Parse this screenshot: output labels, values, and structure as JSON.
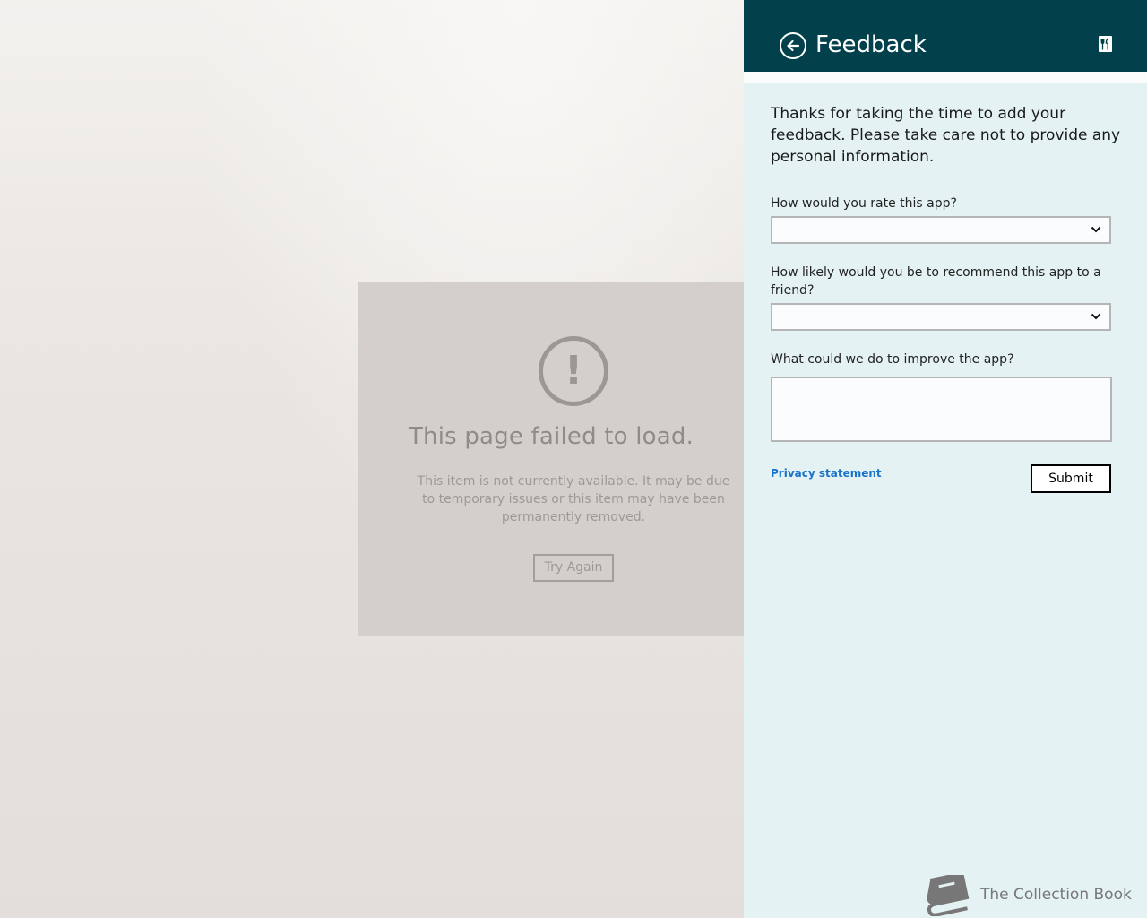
{
  "error_page": {
    "icon": "exclamation-circle-icon",
    "title": "This page failed to load.",
    "message": "This item is not currently available. It may be due to temporary issues or this item may have been permanently removed.",
    "retry_label": "Try Again"
  },
  "feedback": {
    "title": "Feedback",
    "back_icon": "back-arrow-icon",
    "app_icon": "app-icon",
    "intro": "Thanks for taking the time to add your feedback. Please take care not to provide any personal information.",
    "rating_label": "How would you rate this app?",
    "rating_value": "",
    "recommend_label": "How likely would you be to recommend this app to a friend?",
    "recommend_value": "",
    "improve_label": "What could we do to improve the app?",
    "improve_value": "",
    "privacy_label": "Privacy statement",
    "submit_label": "Submit"
  },
  "watermark": {
    "text": "The Collection Book",
    "icon": "book-icon"
  },
  "colors": {
    "header_bg": "#02404b",
    "flyout_bg": "#e4f2f3",
    "link": "#1a73c8"
  }
}
